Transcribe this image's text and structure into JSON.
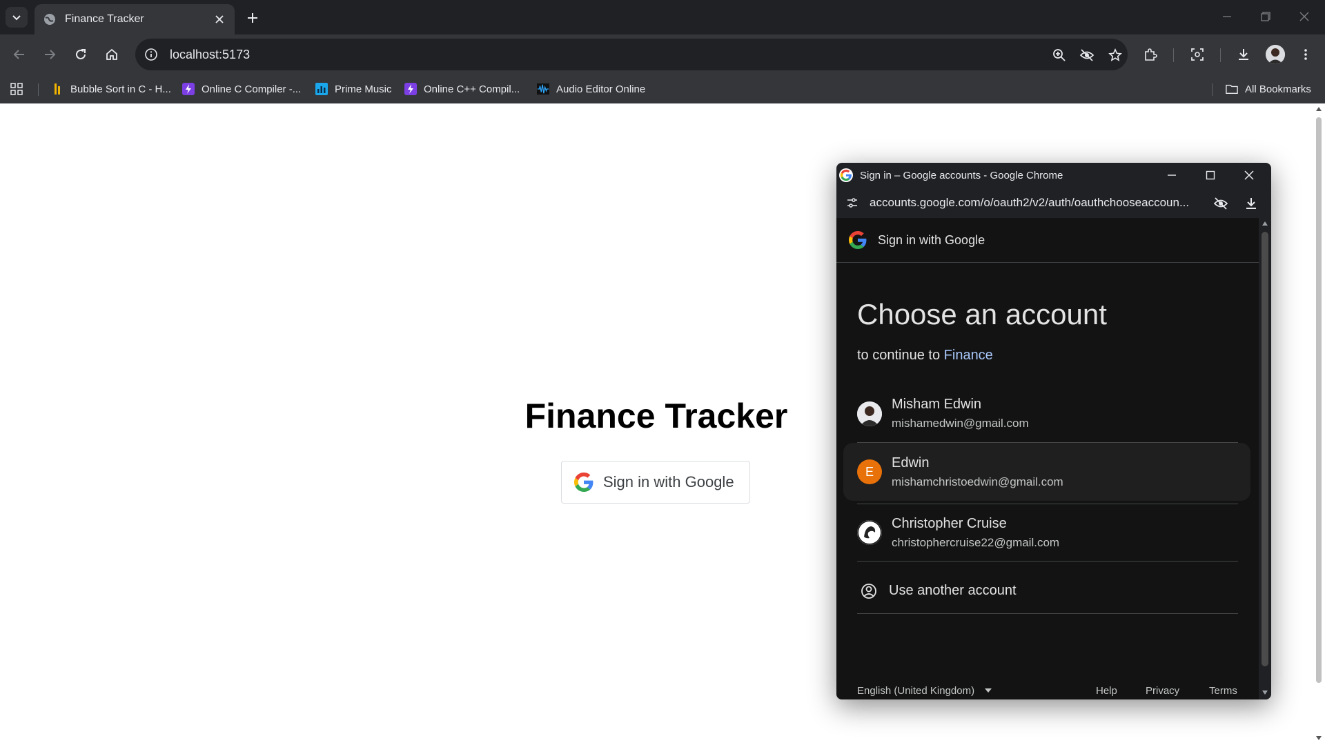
{
  "browser": {
    "tab_title": "Finance Tracker",
    "url": "localhost:5173",
    "bookmarks": [
      "Bubble Sort in C - H...",
      "Online C Compiler -...",
      "Prime Music",
      "Online C++ Compil...",
      "Audio Editor Online"
    ],
    "all_bookmarks_label": "All Bookmarks"
  },
  "page": {
    "title": "Finance Tracker",
    "sign_in_button_label": "Sign in with Google"
  },
  "popup": {
    "window_title": "Sign in – Google accounts - Google Chrome",
    "url": "accounts.google.com/o/oauth2/v2/auth/oauthchooseaccoun...",
    "header_label": "Sign in with Google",
    "heading": "Choose an account",
    "continue_prefix": "to continue to",
    "app_name": "Finance",
    "accounts": [
      {
        "name": "Misham Edwin",
        "email": "mishamedwin@gmail.com"
      },
      {
        "name": "Edwin",
        "email": "mishamchristoedwin@gmail.com",
        "initial": "E"
      },
      {
        "name": "Christopher Cruise",
        "email": "christophercruise22@gmail.com"
      }
    ],
    "use_another_label": "Use another account",
    "language": "English (United Kingdom)",
    "footer_links": [
      "Help",
      "Privacy",
      "Terms"
    ]
  },
  "colors": {
    "chrome_dark": "#202124",
    "chrome_toolbar": "#35363a",
    "google_link_blue": "#a8c7fa",
    "avatar_orange": "#e8710a"
  }
}
